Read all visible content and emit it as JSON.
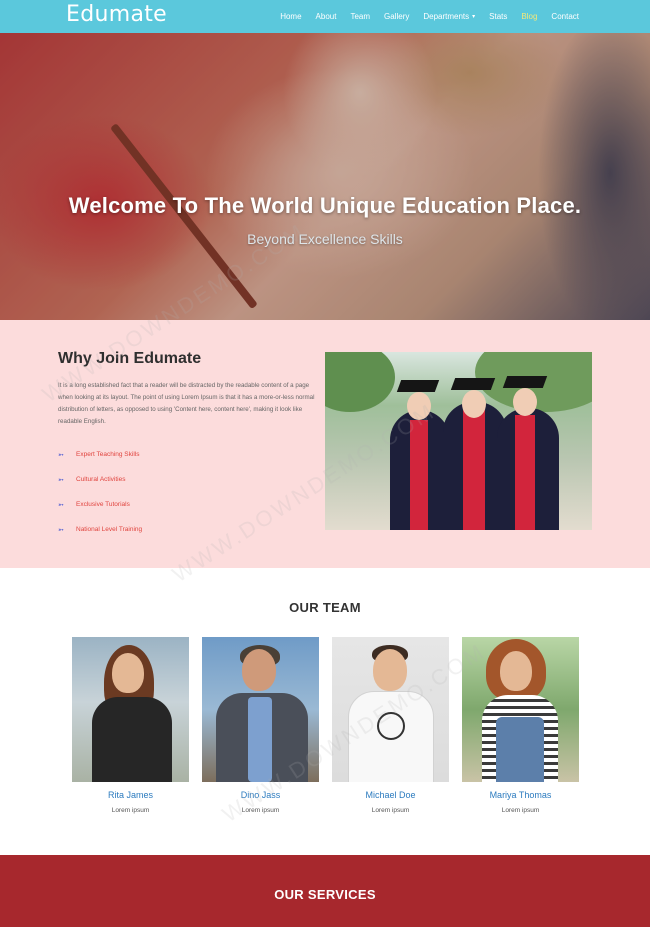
{
  "navbar": {
    "brand": "Edumate",
    "items": [
      {
        "label": "Home"
      },
      {
        "label": "About"
      },
      {
        "label": "Team"
      },
      {
        "label": "Gallery"
      },
      {
        "label": "Departments",
        "caret": "▾"
      },
      {
        "label": "Stats"
      },
      {
        "label": "Blog",
        "active": true
      },
      {
        "label": "Contact"
      }
    ]
  },
  "hero": {
    "title": "Welcome To The World Unique Education Place.",
    "subtitle": "Beyond Excellence Skills"
  },
  "why": {
    "title": "Why Join Edumate",
    "text": "It is a long established fact that a reader will be distracted by the readable content of a page when looking at its layout. The point of using Lorem Ipsum is that it has a more-or-less normal distribution of letters, as opposed to using 'Content here, content here', making it look like readable English.",
    "features": [
      {
        "label": "Expert Teaching Skills",
        "icon": "arrow-icon"
      },
      {
        "label": "Cultural Activities",
        "icon": "arrow-icon"
      },
      {
        "label": "Exclusive Tutorials",
        "icon": "arrow-icon"
      },
      {
        "label": "National Level Training",
        "icon": "arrow-icon"
      }
    ]
  },
  "team": {
    "title": "OUR TEAM",
    "members": [
      {
        "name": "Rita James",
        "role": "Lorem ipsum"
      },
      {
        "name": "Dino Jass",
        "role": "Lorem ipsum"
      },
      {
        "name": "Michael Doe",
        "role": "Lorem ipsum"
      },
      {
        "name": "Mariya Thomas",
        "role": "Lorem ipsum"
      }
    ]
  },
  "services": {
    "title": "OUR SERVICES"
  },
  "watermark": "WWW.DOWNDEMO.COM",
  "colors": {
    "navbar": "#5bc8dc",
    "why_bg": "#fcdcdc",
    "feature_text": "#e0453f",
    "member_name": "#2c7bbf",
    "services_bg": "#a7282d"
  }
}
